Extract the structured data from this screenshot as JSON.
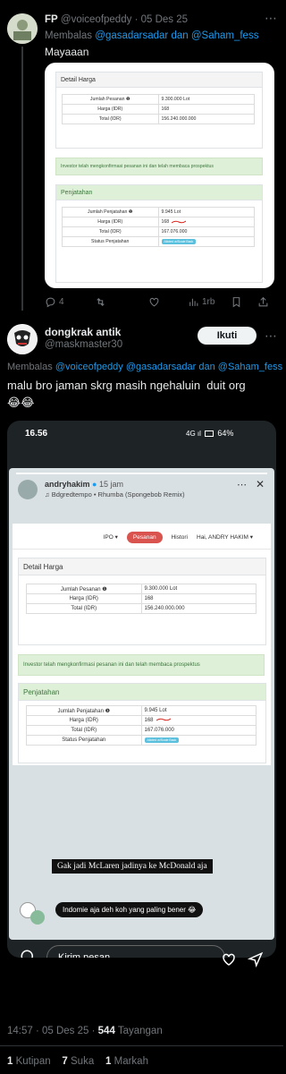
{
  "reply1": {
    "name": "FP",
    "handle": "@voiceofpeddy",
    "date": "· 05 Des 25",
    "reply_prefix": "Membalas",
    "reply_to_1": "@gasadarsadar",
    "reply_and": "dan",
    "reply_to_2": "@Saham_fess",
    "text": "Mayaaan",
    "stats": {
      "replies": "4",
      "views": "1rb"
    }
  },
  "card1": {
    "detail_title": "Detail Harga",
    "rows": [
      {
        "k": "Jumlah Pesanan ❶",
        "v": "9.300.000 Lot"
      },
      {
        "k": "Harga (IDR)",
        "v": "168"
      },
      {
        "k": "Total (IDR)",
        "v": "156.240.000.000"
      }
    ],
    "notice": "Investor telah mengkonfirmasi pesanan ini dan telah membaca prospektus",
    "alloc_title": "Penjatahan",
    "alloc_rows": [
      {
        "k": "Jumlah Penjatahan ❶",
        "v": "9.945 Lot"
      },
      {
        "k": "Harga (IDR)",
        "v": "168"
      },
      {
        "k": "Total (IDR)",
        "v": "167.076.000"
      },
      {
        "k": "Status Penjatahan",
        "v": "Alloted w/Scale Back"
      }
    ]
  },
  "reply2": {
    "name": "dongkrak antik",
    "handle": "@maskmaster30",
    "follow": "Ikuti",
    "reply_prefix": "Membalas",
    "reply_to_1": "@voiceofpeddy",
    "reply_to_2": "@gasadarsadar",
    "reply_and": "dan",
    "reply_to_3": "@Saham_fess",
    "text": "malu bro jaman skrg masih ngehaluin  duit org",
    "emoji": "😂😂"
  },
  "phone": {
    "time": "16.56",
    "status_icons": "4G ıl",
    "battery": "64%",
    "story_user": "andryhakim",
    "story_time": "15 jam",
    "story_music": "♫ Bdgredtempo • Rhumba (Spongebob Remix)",
    "nav": {
      "ipo": "IPO ▾",
      "pesanan": "Pesanan",
      "histori": "Histori",
      "user": "Hai, ANDRY HAKIM ▾"
    },
    "caption": "Gak jadi McLaren jadinya ke McDonald aja",
    "comment": "Indomie aja deh koh yang paling bener 😂",
    "input_placeholder": "Kirim pesan"
  },
  "footer": {
    "timestamp": "14:57 · 05 Des 25 ·",
    "views_count": "544",
    "views_label": "Tayangan",
    "quotes_count": "1",
    "quotes_label": "Kutipan",
    "likes_count": "7",
    "likes_label": "Suka",
    "bookmarks_count": "1",
    "bookmarks_label": "Markah"
  }
}
